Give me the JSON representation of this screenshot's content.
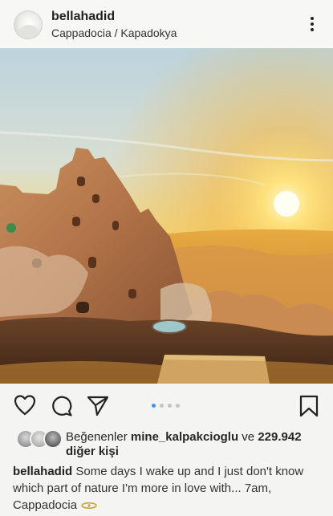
{
  "post": {
    "username": "bellahadid",
    "location": "Cappadocia / Kapadokya"
  },
  "likes": {
    "prefix": "Beğenenler",
    "user": "mine_kalpakcioglu",
    "connector": "ve",
    "count": "229.942",
    "suffix": "diğer kişi"
  },
  "carousel": {
    "total": 4,
    "active": 1
  },
  "caption": {
    "username": "bellahadid",
    "text": "Some days I wake up and I just don't know which part of nature I'm more in love with... 7am, Cappadocia",
    "emoji": "sun-icon"
  },
  "icons": {
    "like": "heart-icon",
    "comment": "comment-icon",
    "share": "paper-plane-icon",
    "save": "bookmark-icon",
    "more": "more-options-icon"
  },
  "colors": {
    "carousel_active": "#3897f0",
    "carousel_inactive": "#c4c4c4"
  }
}
